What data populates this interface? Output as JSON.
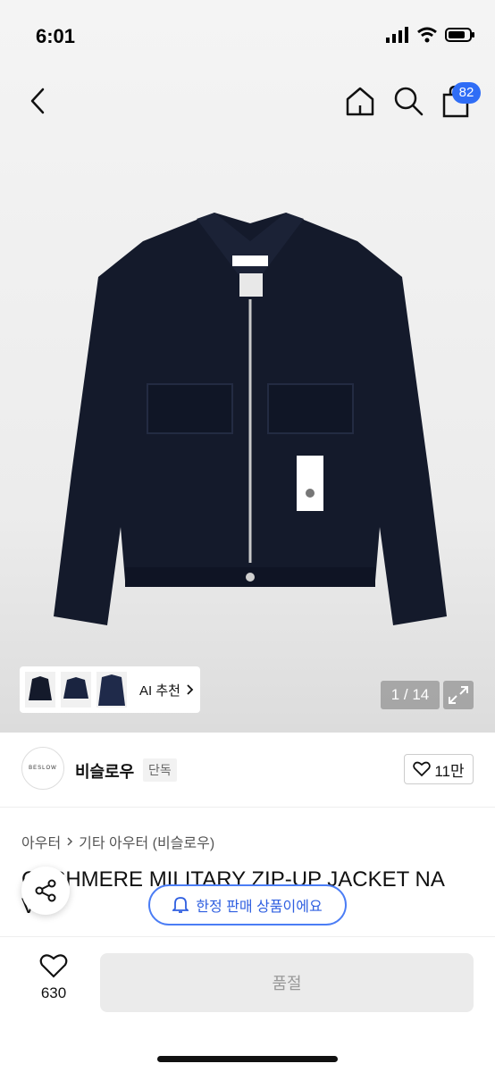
{
  "status": {
    "time": "6:01"
  },
  "nav": {
    "cart_count": "82"
  },
  "gallery": {
    "pager": "1 / 14",
    "ai_reco_label": "AI 추천"
  },
  "brand": {
    "logo_text": "BESLOW",
    "name": "비슬로우",
    "tag": "단독",
    "likes": "11만"
  },
  "breadcrumb": [
    "아우터",
    "기타 아우터 (비슬로우)"
  ],
  "product": {
    "title_line1": "CASHMERE MILITARY ZIP-UP JACKET NA",
    "title_line2": "VY"
  },
  "notice": {
    "soldout_label": "한정 판매 상품이에요"
  },
  "bottom": {
    "wish_count": "630",
    "buy_label": "품절"
  },
  "colors": {
    "accent": "#2f6df6",
    "jacket": "#141a2b"
  }
}
